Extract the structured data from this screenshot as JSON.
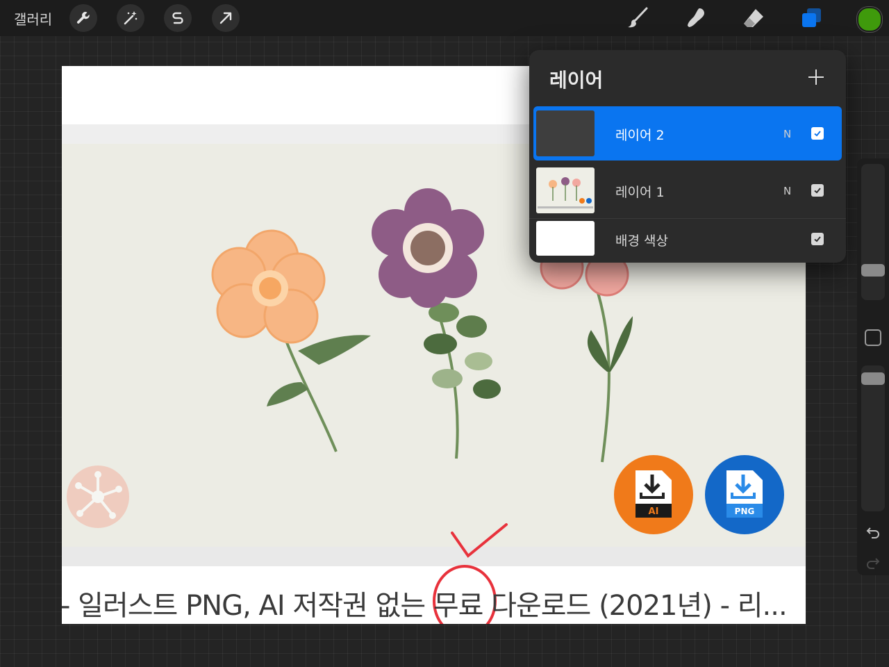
{
  "toolbar": {
    "gallery_label": "갤러리",
    "left_tools": [
      "wrench-icon",
      "magic-wand-icon",
      "selection-icon",
      "transform-arrow-icon"
    ],
    "right_tools": [
      "brush-icon",
      "smudge-icon",
      "eraser-icon",
      "layers-icon"
    ],
    "active_tool": "layers-icon",
    "current_color": "#3f9a0c"
  },
  "layers_panel": {
    "title": "레이어",
    "add_icon": "plus-icon",
    "layers": [
      {
        "name": "레이어 2",
        "mode": "N",
        "visible": true,
        "selected": true
      },
      {
        "name": "레이어 1",
        "mode": "N",
        "visible": true,
        "selected": false
      },
      {
        "name": "배경 색상",
        "mode": "",
        "visible": true,
        "selected": false
      }
    ]
  },
  "canvas": {
    "caption": "- 일러스트 PNG, AI 저작권 없는 무료 다운로드 (2021년) - 리...",
    "badge_ai": "AI",
    "badge_png": "PNG",
    "annotation_color": "#e8323c"
  },
  "sidebar": {
    "undo_icon": "undo-icon",
    "redo_icon": "redo-icon"
  }
}
